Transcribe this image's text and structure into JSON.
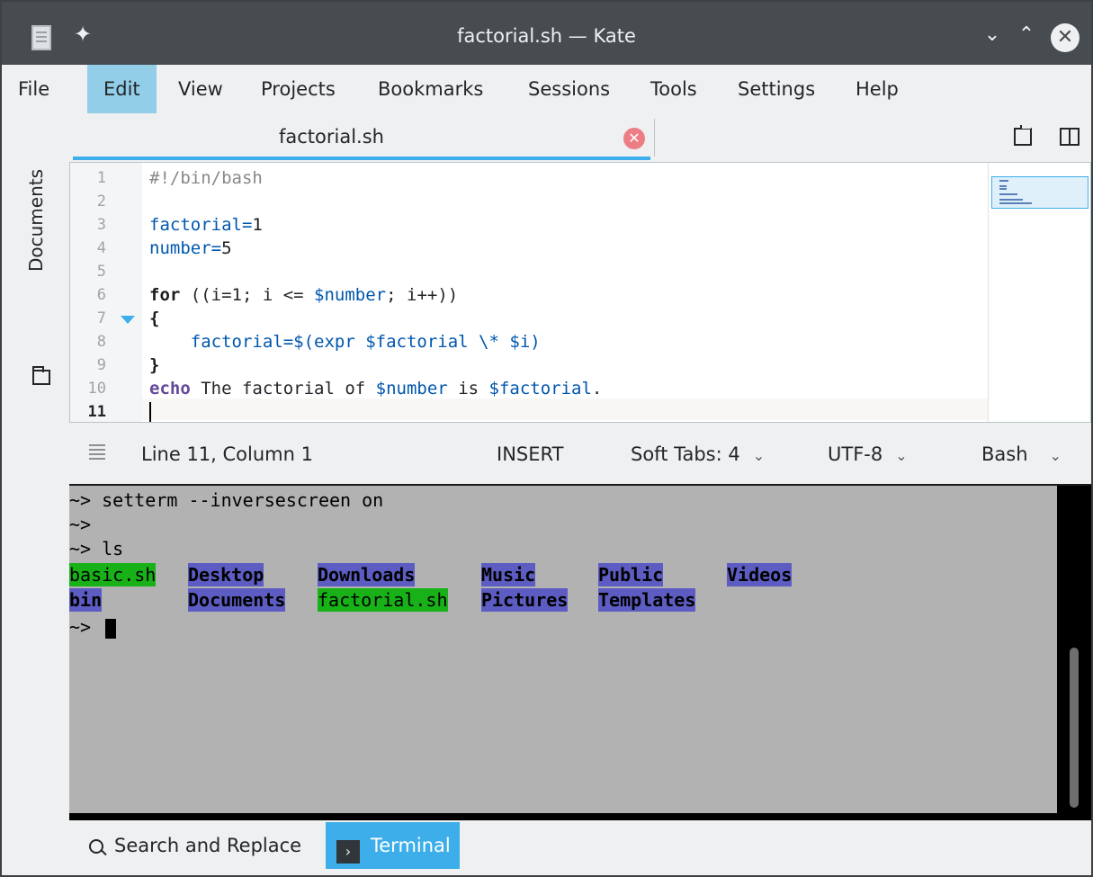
{
  "window": {
    "title": "factorial.sh — Kate",
    "pin_glyph": "✦",
    "minimize_glyph": "⌄",
    "maximize_glyph": "⌃",
    "close_glyph": "✕"
  },
  "menubar": {
    "items": [
      "File",
      "Edit",
      "View",
      "Projects",
      "Bookmarks",
      "Sessions",
      "Tools",
      "Settings",
      "Help"
    ],
    "active": "Edit"
  },
  "sidebar": {
    "documents_label": "Documents"
  },
  "tabs": [
    {
      "label": "factorial.sh",
      "close_glyph": "✕",
      "active": true
    }
  ],
  "editor": {
    "line_numbers": [
      "1",
      "2",
      "3",
      "4",
      "5",
      "6",
      "7",
      "8",
      "9",
      "10",
      "11"
    ],
    "current_line": "11",
    "folding_marker_line": "7"
  },
  "statusbar": {
    "position": "Line 11, Column 1",
    "mode": "INSERT",
    "indent": "Soft Tabs: 4",
    "encoding": "UTF-8",
    "syntax": "Bash",
    "dropdown_glyph": "⌄"
  },
  "terminal": {
    "lines": [
      "~> setterm --inversescreen on",
      "~>",
      "~> ls"
    ],
    "ls_row1": [
      "basic.sh",
      "Desktop",
      "Downloads",
      "Music",
      "Public",
      "Videos"
    ],
    "ls_row2": [
      "bin",
      "Documents",
      "factorial.sh",
      "Pictures",
      "Templates"
    ],
    "prompt": "~>"
  },
  "tool_tabs": {
    "search": "Search and Replace",
    "terminal": "Terminal",
    "terminal_icon_glyph": "›"
  },
  "colors": {
    "accent": "#3daee9",
    "menu_active": "#93cee9",
    "titlebar": "#474c51",
    "terminal_bg": "#b2b2b2",
    "exec_highlight": "#18b218",
    "dir_highlight": "#5c5cc2",
    "close_tab": "#ed7d84"
  }
}
